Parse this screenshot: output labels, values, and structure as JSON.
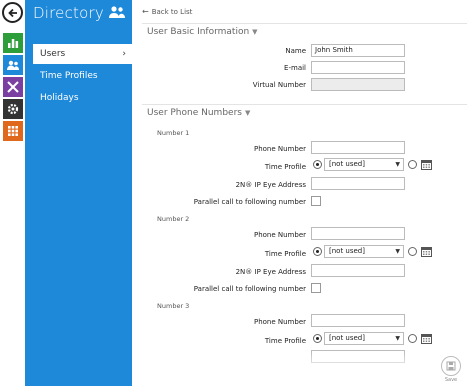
{
  "sidebar": {
    "title": "Directory",
    "items": [
      {
        "label": "Users",
        "active": true
      },
      {
        "label": "Time Profiles",
        "active": false
      },
      {
        "label": "Holidays",
        "active": false
      }
    ]
  },
  "rail": {
    "icons": [
      {
        "name": "back-arrow-icon"
      },
      {
        "name": "status-chart-icon",
        "color": "#2e9e3a"
      },
      {
        "name": "directory-users-icon",
        "color": "#1e88d9"
      },
      {
        "name": "hardware-tools-icon",
        "color": "#7a3fa0"
      },
      {
        "name": "services-gear-icon",
        "color": "#333333"
      },
      {
        "name": "system-grid-icon",
        "color": "#e0681c"
      }
    ]
  },
  "main": {
    "back_link": "Back to List",
    "basic": {
      "title": "User Basic Information",
      "name_label": "Name",
      "name_value": "John Smith",
      "email_label": "E-mail",
      "email_value": "",
      "vnum_label": "Virtual Number",
      "vnum_value": ""
    },
    "phones": {
      "title": "User Phone Numbers",
      "phone_label": "Phone Number",
      "time_profile_label": "Time Profile",
      "ip_label": "2N® IP Eye Address",
      "parallel_label": "Parallel call to following number",
      "not_used": "[not used]",
      "numbers": [
        {
          "label": "Number 1"
        },
        {
          "label": "Number 2"
        },
        {
          "label": "Number 3"
        }
      ]
    },
    "save_label": "Save"
  },
  "colors": {
    "sidebar_bg": "#1e88d9",
    "accent": "#1e88d9"
  }
}
